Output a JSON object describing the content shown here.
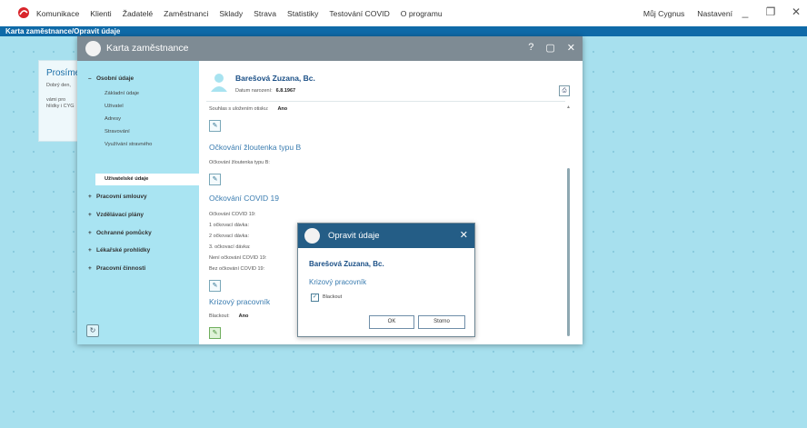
{
  "menu": {
    "items": [
      "Komunikace",
      "Klienti",
      "Žadatelé",
      "Zaměstnanci",
      "Sklady",
      "Strava",
      "Statistiky",
      "Testování COVID",
      "O programu"
    ],
    "right": [
      "Můj Cygnus",
      "Nastavení"
    ]
  },
  "breadcrumb": "Karta zaměstnance/Opravit údaje",
  "background_card": {
    "title": "Prosíme",
    "lines": [
      "Dobrý den,",
      "vámi pro",
      "hlídky i CYG"
    ]
  },
  "window": {
    "title": "Karta zaměstnance",
    "controls": [
      "?",
      "▢",
      "✕"
    ]
  },
  "sidebar": {
    "main_section": "Osobní údaje",
    "sub_items": [
      "Základní údaje",
      "Uživatel",
      "Adresy",
      "Stravování",
      "Využívání stravného",
      "Uživatelské údaje"
    ],
    "active_sub": "Uživatelské údaje",
    "groups": [
      "Pracovní smlouvy",
      "Vzdělávací plány",
      "Ochranné pomůcky",
      "Lékařské prohlídky",
      "Pracovní činnosti"
    ]
  },
  "employee": {
    "name": "Barešová Zuzana, Bc.",
    "dob_label": "Datum narození:",
    "dob_value": "6.8.1967"
  },
  "content": {
    "consent_label": "Souhlas s uložením otisku:",
    "consent_value": "Ano",
    "hep_title": "Očkování žloutenka typu B",
    "hep_label": "Očkování žloutenka typu B:",
    "covid_title": "Očkování COVID 19",
    "covid_lines": [
      "Očkování COVID 19:",
      "1 očkovací dávka:",
      "2 očkovací dávka:",
      "3. očkovací dávka:",
      "Není očkování COVID 19:",
      "Bez očkování COVID 19:"
    ],
    "crisis_title": "Krizový pracovník",
    "blackout_label": "Blackout:",
    "blackout_value": "Ano"
  },
  "dialog": {
    "title": "Opravit údaje",
    "name": "Barešová Zuzana, Bc.",
    "section": "Krizový pracovník",
    "checkbox_label": "Blackout",
    "checked": true,
    "ok": "OK",
    "cancel": "Storno"
  },
  "colors": {
    "accent_blue": "#0f6aa8",
    "sidebar_bg": "#a9e4f2",
    "dialog_title": "#245d86",
    "window_title": "#7e8b94"
  }
}
